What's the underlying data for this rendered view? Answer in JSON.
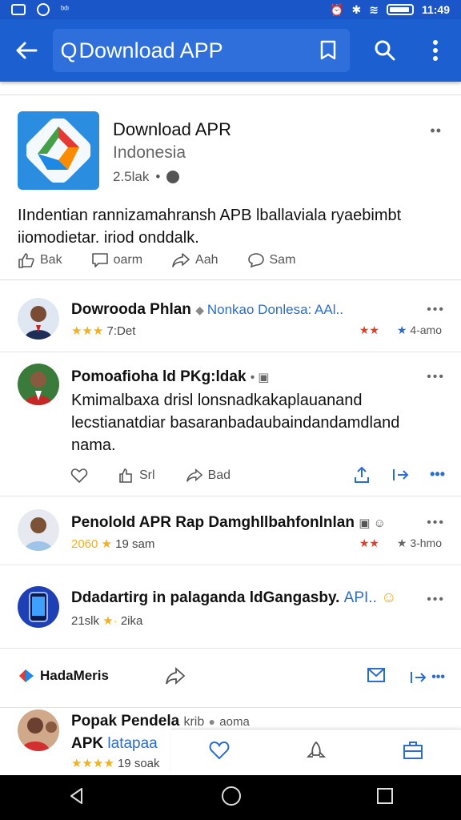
{
  "status_bar": {
    "time": "11:49"
  },
  "app_bar": {
    "search_text": "Download APP",
    "search_prefix": "Q"
  },
  "app_card": {
    "title": "Download APR",
    "subtitle": "Indonesia",
    "meta": "2.5lak",
    "description": "IIndentian rannizamahransh APB lballaviala ryaebimbt iiomodietar. iriod onddalk.",
    "actions": [
      "Bak",
      "oarm",
      "Aah",
      "Sam"
    ]
  },
  "feed": [
    {
      "name": "Dowrooda Phlan",
      "tag": "Nonkao Donlesa: AAl..",
      "rating": "★★★",
      "meta": "7:Det",
      "right_meta": "4-amo"
    },
    {
      "name": "Pomoafioha ld PKg:ldak",
      "text": "Kmimalbaxa drisl lonsnadkakaplauanand lecstianatdiar basaranbadaubaindandamdland nama.",
      "actions": [
        "",
        "Srl",
        "Bad"
      ]
    },
    {
      "name": "Penolold APR Rap Damghllbahfonlnlan",
      "rating_label": "2060",
      "meta": "19 sam",
      "right_meta": "3-hmo"
    },
    {
      "name": "Ddadartirg in palaganda ldGangasby.",
      "tag": "API..",
      "meta": "21slk",
      "meta2": "2ika"
    }
  ],
  "section": {
    "label": "HadaMeris"
  },
  "last_item": {
    "name": "Popak Pendela",
    "name_suffix": "krib",
    "meta_suffix": "aoma",
    "line2": "APK",
    "tag": "latapaa",
    "meta": "19 soak"
  },
  "colors": {
    "app_bar": "#1b5fd0",
    "status_bar": "#1a56c7",
    "accent_blue": "#2b6ccf",
    "star": "#f2b01e"
  }
}
